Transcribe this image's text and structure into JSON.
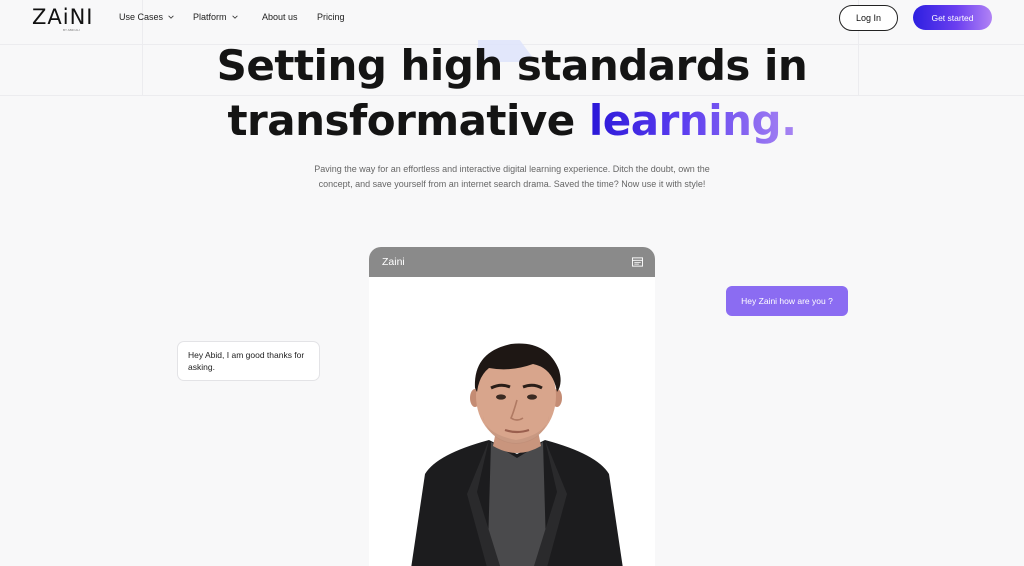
{
  "nav": {
    "logo": "ZAiNI",
    "logo_sub": "BY ABID ALI",
    "items": [
      {
        "label": "Use Cases",
        "has_dropdown": true
      },
      {
        "label": "Platform",
        "has_dropdown": true
      },
      {
        "label": "About us",
        "has_dropdown": false
      },
      {
        "label": "Pricing",
        "has_dropdown": false
      }
    ],
    "login_label": "Log In",
    "cta_label": "Get started"
  },
  "hero": {
    "line1": "Setting high standards in",
    "line2_plain": "transformative ",
    "line2_accent": "learning.",
    "subtitle": "Paving the way for an effortless and interactive digital learning experience. Ditch the doubt, own the concept, and save yourself from an internet search drama. Saved the time? Now use it with style!"
  },
  "phone": {
    "title": "Zaini",
    "header_icon": "chat-window-icon"
  },
  "chat": {
    "user_message": "Hey Zaini how are you ?",
    "bot_message": "Hey Abid, I am good thanks for asking."
  },
  "colors": {
    "accent_start": "#2a17d8",
    "accent_end": "#a986f2",
    "user_bubble": "#8b6cf2",
    "phone_header": "#8a8a8a",
    "page_bg": "#f8f8f9"
  }
}
